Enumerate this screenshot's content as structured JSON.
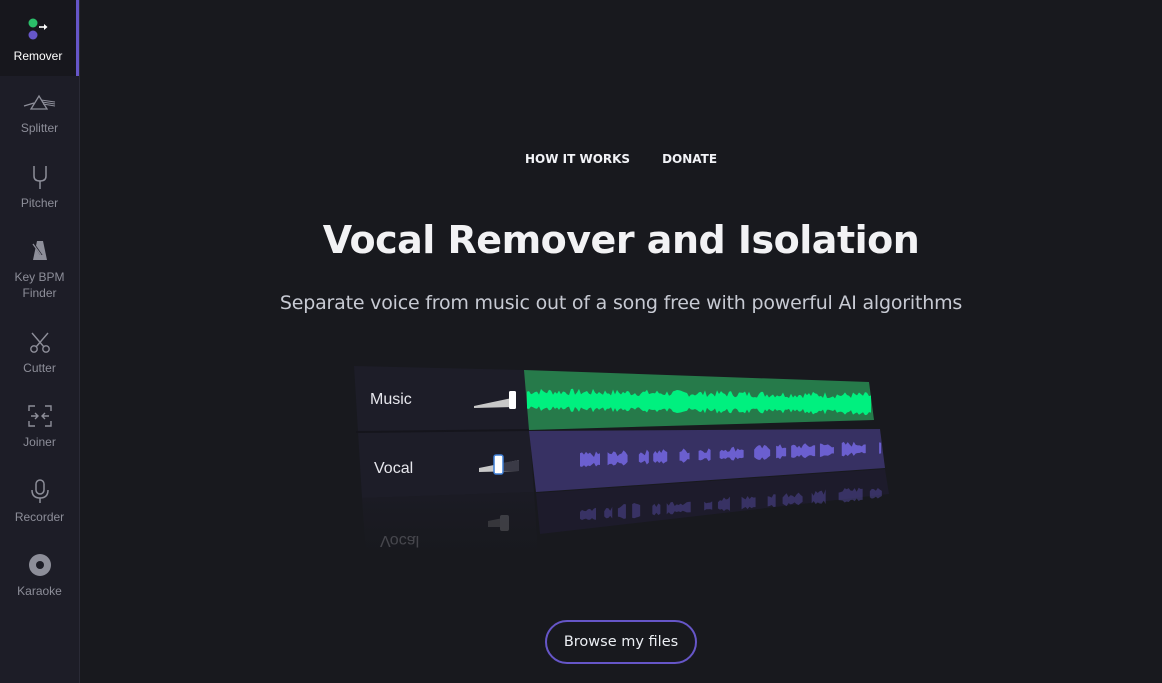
{
  "sidebar": {
    "items": [
      {
        "label": "Remover",
        "icon": "remover-icon",
        "active": true
      },
      {
        "label": "Splitter",
        "icon": "prism-icon"
      },
      {
        "label": "Pitcher",
        "icon": "tuning-fork-icon"
      },
      {
        "label": "Key BPM\nFinder",
        "label_line1": "Key BPM",
        "label_line2": "Finder",
        "icon": "metronome-icon"
      },
      {
        "label": "Cutter",
        "icon": "scissors-icon"
      },
      {
        "label": "Joiner",
        "icon": "joiner-icon"
      },
      {
        "label": "Recorder",
        "icon": "microphone-icon"
      },
      {
        "label": "Karaoke",
        "icon": "disc-icon"
      }
    ]
  },
  "header": {
    "links": [
      {
        "label": "HOW IT WORKS"
      },
      {
        "label": "DONATE"
      }
    ]
  },
  "hero": {
    "title": "Vocal Remover and Isolation",
    "subtitle": "Separate voice from music out of a song free with powerful AI algorithms"
  },
  "illustration": {
    "tracks": [
      {
        "label": "Music",
        "volume": 1.0,
        "color": "#00f07f",
        "bg": "#267a4a"
      },
      {
        "label": "Vocal",
        "volume": 0.3,
        "color": "#6b5fcf",
        "bg": "#373163"
      }
    ],
    "reflection_label": "Vocal"
  },
  "actions": {
    "browse_label": "Browse my files"
  },
  "colors": {
    "accent": "#6656c8",
    "background": "#18191e",
    "sidebar": "#1d1d27",
    "music_wave": "#00f07f",
    "vocal_wave": "#6b5fcf",
    "dot_green": "#2bbf6a",
    "dot_purple": "#6656c8"
  }
}
